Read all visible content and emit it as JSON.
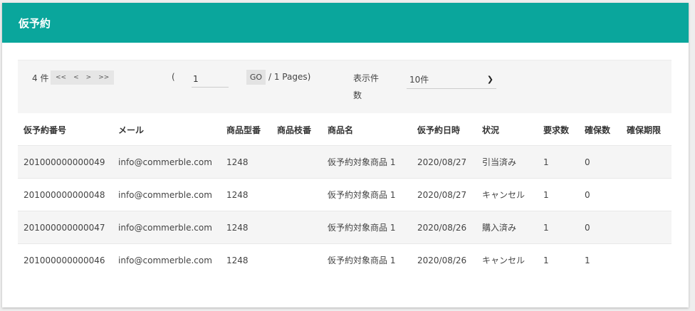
{
  "header": {
    "title": "仮予約"
  },
  "toolbar": {
    "count": "4 件",
    "first": "<<",
    "prev": "<",
    "next": ">",
    "last": ">>",
    "open_paren": "(",
    "page_value": "1",
    "go": "GO",
    "pages": "/ 1 Pages)",
    "per_page_label": "表示件数",
    "per_page_value": "10件"
  },
  "table": {
    "headers": [
      "仮予約番号",
      "メール",
      "商品型番",
      "商品枝番",
      "商品名",
      "仮予約日時",
      "状況",
      "要求数",
      "確保数",
      "確保期限"
    ],
    "rows": [
      [
        "201000000000049",
        "info@commerble.com",
        "1248",
        "",
        "仮予約対象商品 1",
        "2020/08/27",
        "引当済み",
        "1",
        "0",
        ""
      ],
      [
        "201000000000048",
        "info@commerble.com",
        "1248",
        "",
        "仮予約対象商品 1",
        "2020/08/27",
        "キャンセル",
        "1",
        "0",
        ""
      ],
      [
        "201000000000047",
        "info@commerble.com",
        "1248",
        "",
        "仮予約対象商品 1",
        "2020/08/26",
        "購入済み",
        "1",
        "0",
        ""
      ],
      [
        "201000000000046",
        "info@commerble.com",
        "1248",
        "",
        "仮予約対象商品 1",
        "2020/08/26",
        "キャンセル",
        "1",
        "1",
        ""
      ]
    ]
  }
}
